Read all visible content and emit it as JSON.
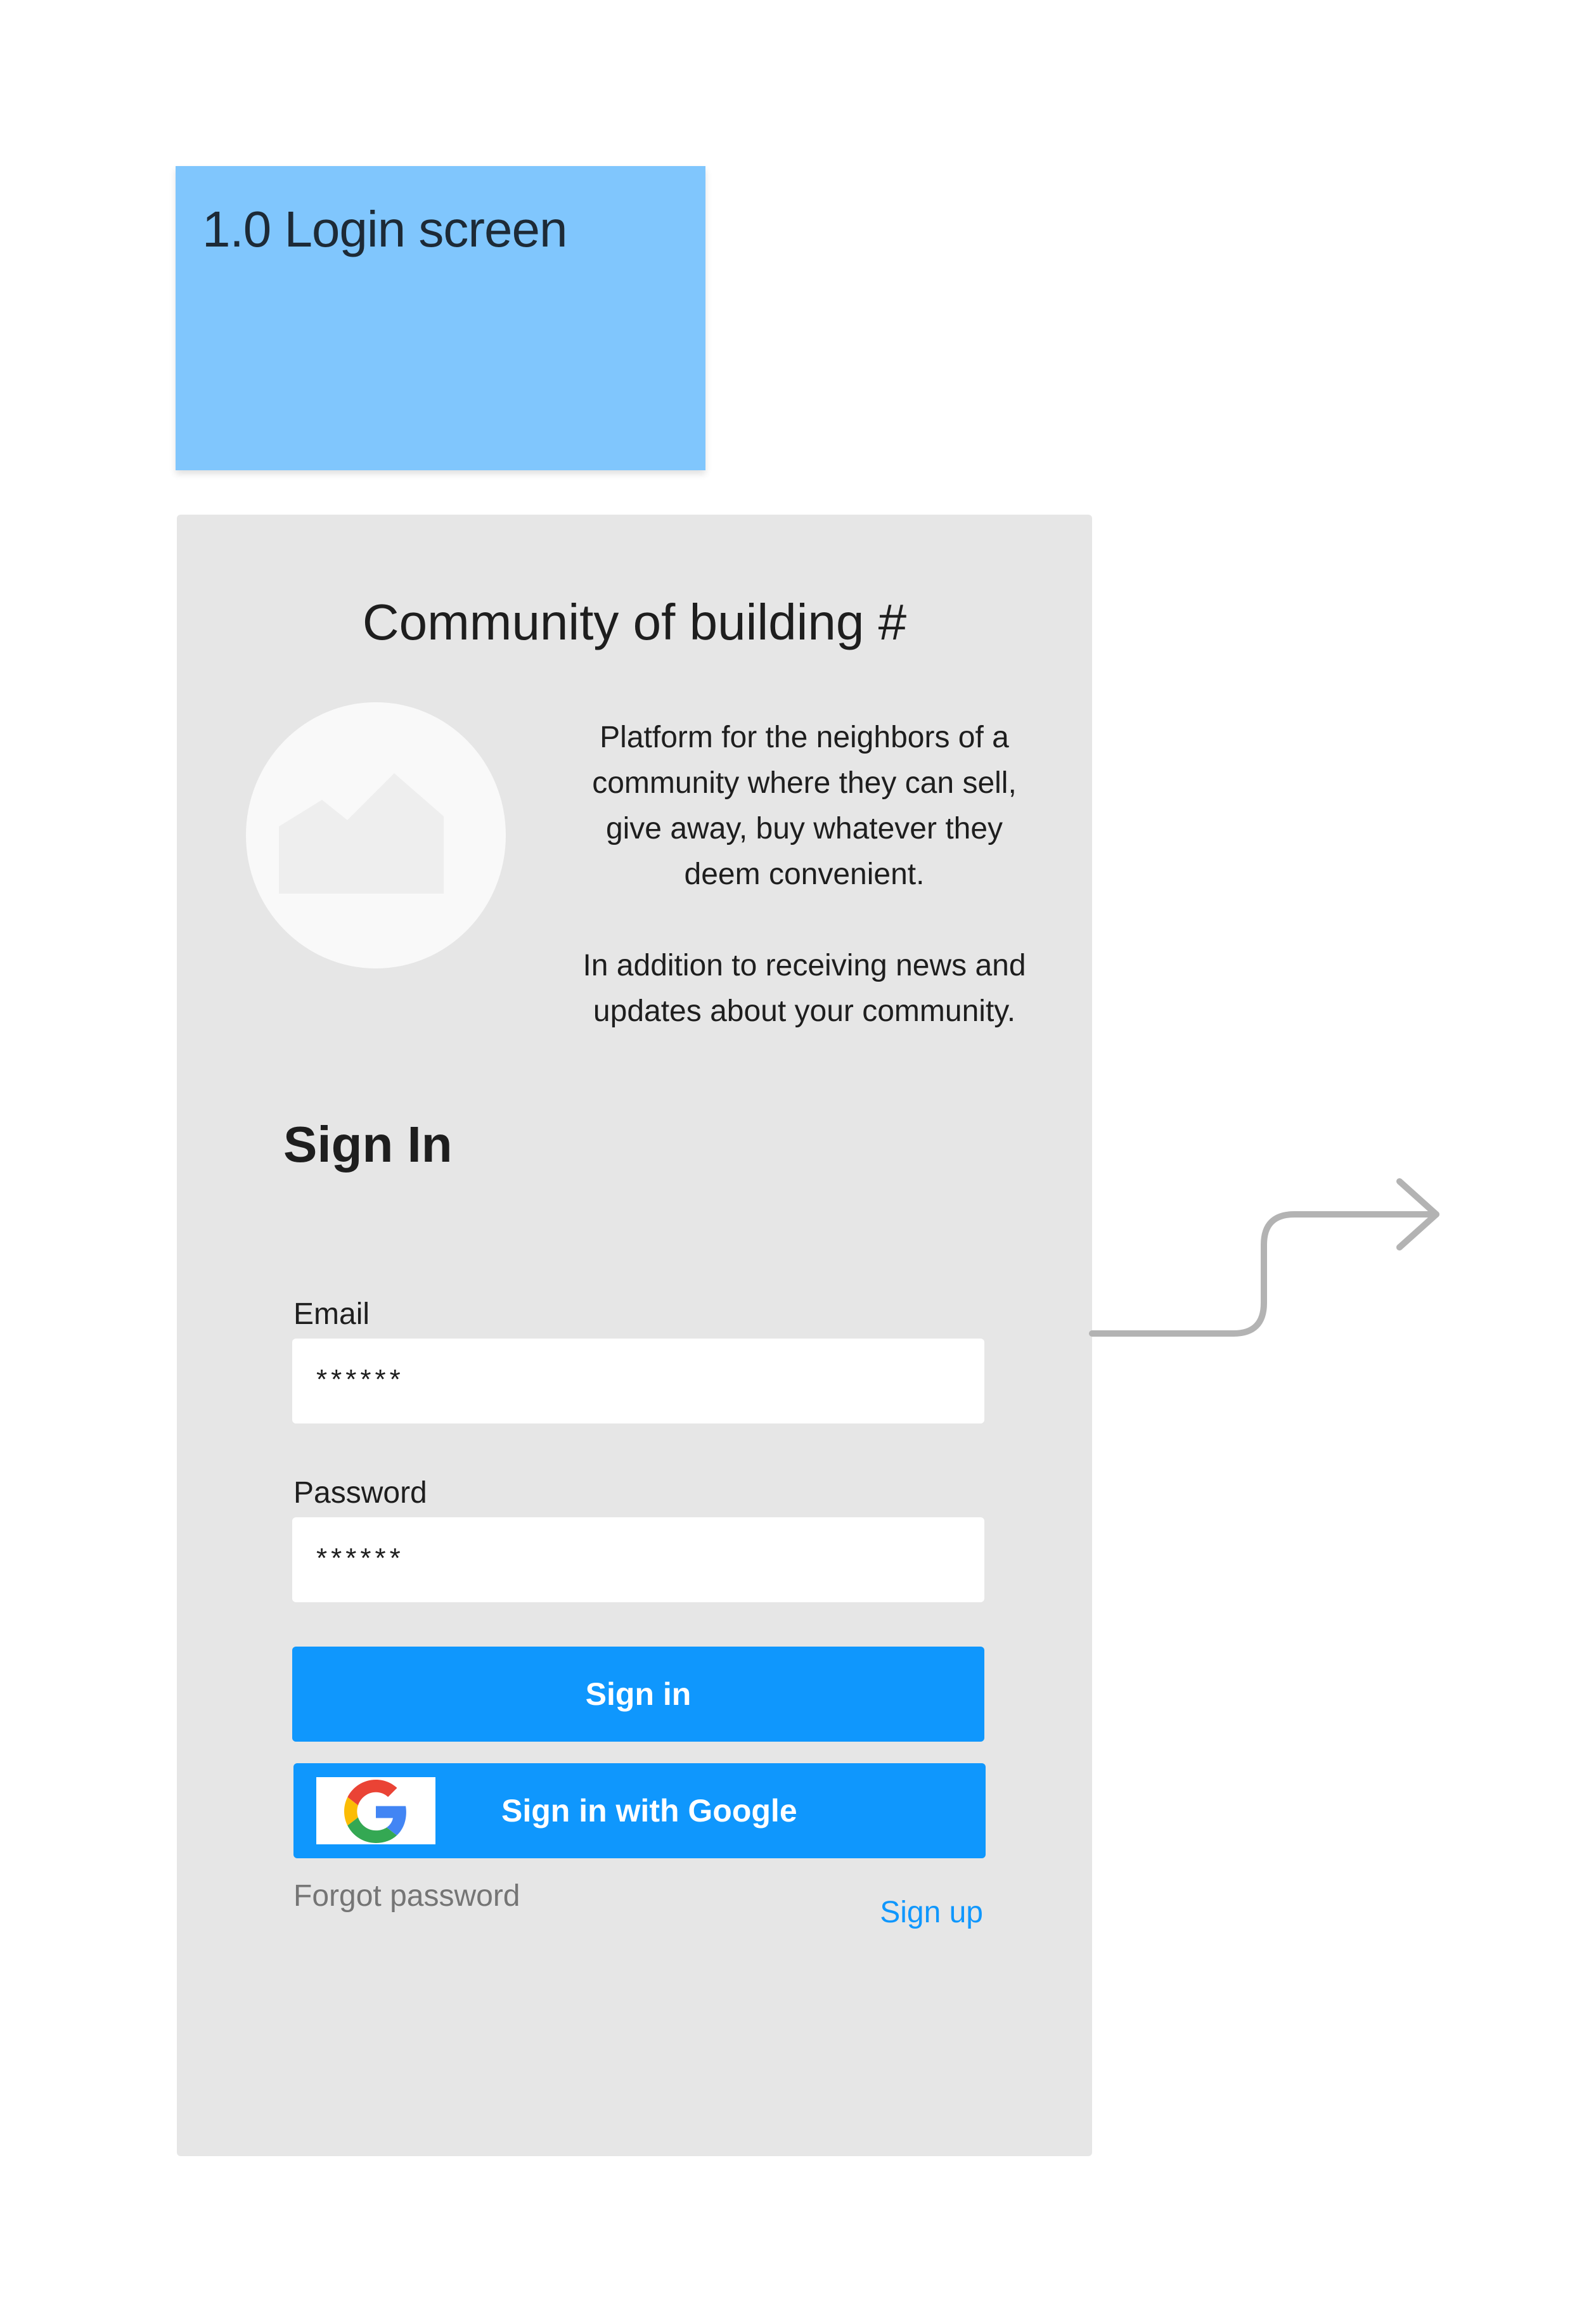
{
  "sticky_note": {
    "title": "1.0 Login screen",
    "color": "#80c6fd"
  },
  "screen": {
    "title": "Community of building #",
    "image_placeholder_icon": "image-placeholder-icon",
    "description": {
      "paragraph_1": "Platform for the neighbors of a community where they can sell, give away, buy whatever they deem convenient.",
      "paragraph_2": "In addition to receiving news and updates about your community."
    },
    "sign_in_heading": "Sign In",
    "email": {
      "label": "Email",
      "value": "******"
    },
    "password": {
      "label": "Password",
      "value": "******"
    },
    "sign_in_button": "Sign in",
    "google_button": {
      "label": "Sign in with Google",
      "icon": "google-icon"
    },
    "forgot_password": "Forgot password",
    "sign_up": "Sign up"
  },
  "colors": {
    "panel_background": "#e6e6e6",
    "primary_button": "#0f97fd",
    "link": "#0f97fd",
    "muted_text": "#757575",
    "connector": "#b3b3b3"
  },
  "connector": {
    "icon": "flow-arrow-icon"
  }
}
